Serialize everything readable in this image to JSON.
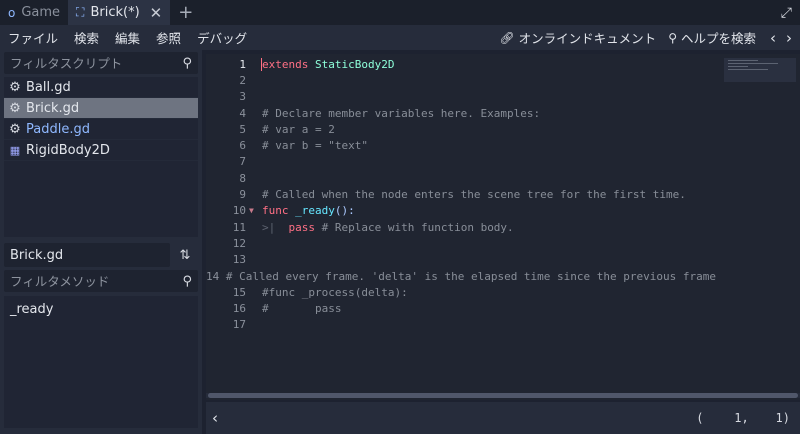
{
  "tabs": [
    {
      "label": "Game",
      "icon": "o",
      "active": false
    },
    {
      "label": "Brick(*)",
      "icon": "⛶",
      "active": true
    }
  ],
  "menu": {
    "items": [
      "ファイル",
      "検索",
      "編集",
      "参照",
      "デバッグ"
    ],
    "online_docs": "オンラインドキュメント",
    "search_help": "ヘルプを検索"
  },
  "script_filter_placeholder": "フィルタスクリプト",
  "scripts": [
    {
      "name": "Ball.gd",
      "icon": "gear-icon",
      "selected": false
    },
    {
      "name": "Brick.gd",
      "icon": "gear-icon",
      "selected": true
    },
    {
      "name": "Paddle.gd",
      "icon": "gear-icon",
      "selected": false
    },
    {
      "name": "RigidBody2D",
      "icon": "node-doc-icon",
      "selected": false
    }
  ],
  "current_file": "Brick.gd",
  "method_filter_placeholder": "フィルタメソッド",
  "methods": [
    "_ready"
  ],
  "code_lines": [
    "extends StaticBody2D",
    "",
    "",
    "# Declare member variables here. Examples:",
    "# var a = 2",
    "# var b = \"text\"",
    "",
    "",
    "# Called when the node enters the scene tree for the first time.",
    "func _ready():",
    "\tpass # Replace with function body.",
    "",
    "",
    "# Called every frame. 'delta' is the elapsed time since the previous frame",
    "#func _process(delta):",
    "#\tpass",
    ""
  ],
  "status": {
    "line": 1,
    "column": 1
  },
  "colors": {
    "keyword": "#ff7085",
    "type": "#8effda",
    "comment": "#888e98",
    "function": "#66e6ff",
    "string": "#ffeda1",
    "caret": "#ff6f83"
  }
}
